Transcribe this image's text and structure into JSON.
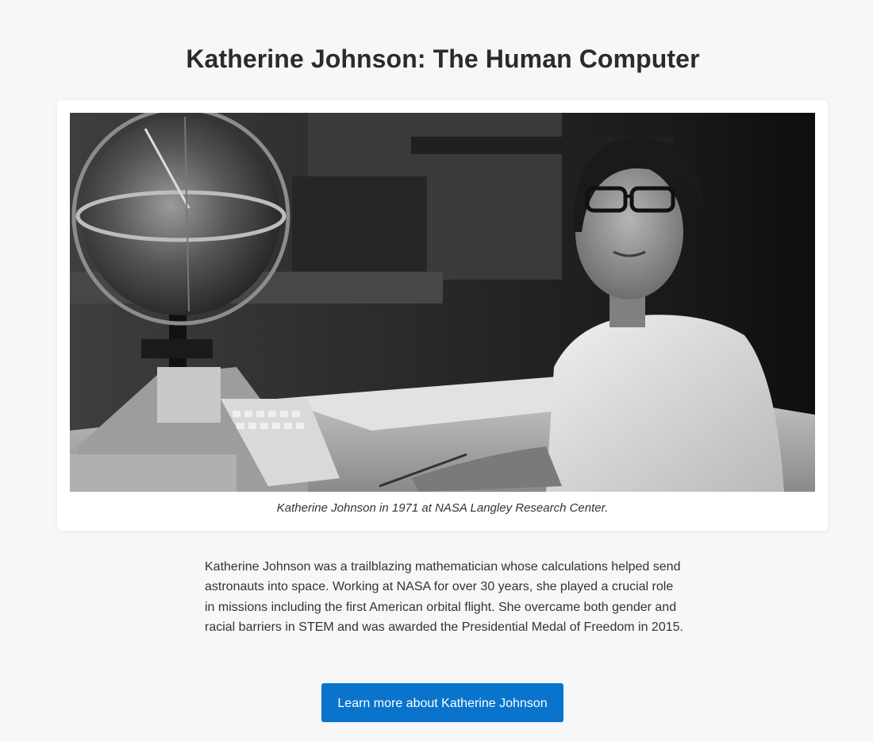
{
  "page": {
    "title": "Katherine Johnson: The Human Computer"
  },
  "figure": {
    "caption": "Katherine Johnson in 1971 at NASA Langley Research Center.",
    "image_subject": "black-and-white photo of Katherine Johnson seated at a desk with a celestial globe and calculating machine"
  },
  "bio": {
    "text": "Katherine Johnson was a trailblazing mathematician whose calculations helped send astronauts into space. Working at NASA for over 30 years, she played a crucial role in missions including the first American orbital flight. She overcame both gender and racial barriers in STEM and was awarded the Presidential Medal of Freedom in 2015."
  },
  "cta": {
    "label": "Learn more about Katherine Johnson"
  },
  "colors": {
    "background": "#f7f7f8",
    "card": "#ffffff",
    "button": "#0a74cc",
    "button_text": "#ffffff",
    "text": "#333333"
  }
}
